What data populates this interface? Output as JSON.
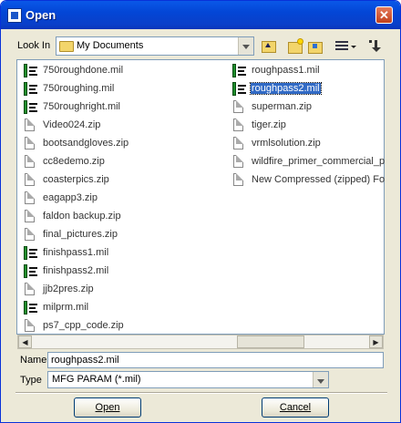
{
  "window": {
    "title": "Open",
    "close_glyph": "✕"
  },
  "lookin": {
    "label": "Look In",
    "value": "My Documents"
  },
  "toolbar": {
    "icons": [
      "up-folder-icon",
      "new-folder-icon",
      "home-folder-icon",
      "view-menu-icon",
      "details-icon"
    ]
  },
  "files": {
    "col1": [
      {
        "name": "750roughdone.mil",
        "type": "mil"
      },
      {
        "name": "750roughing.mil",
        "type": "mil"
      },
      {
        "name": "750roughright.mil",
        "type": "mil"
      },
      {
        "name": "Video024.zip",
        "type": "doc"
      },
      {
        "name": "bootsandgloves.zip",
        "type": "doc"
      },
      {
        "name": "cc8edemo.zip",
        "type": "doc"
      },
      {
        "name": "coasterpics.zip",
        "type": "doc"
      },
      {
        "name": "eagapp3.zip",
        "type": "doc"
      },
      {
        "name": "faldon backup.zip",
        "type": "doc"
      },
      {
        "name": "final_pictures.zip",
        "type": "doc"
      },
      {
        "name": "finishpass1.mil",
        "type": "mil"
      },
      {
        "name": "finishpass2.mil",
        "type": "mil"
      },
      {
        "name": "jjb2pres.zip",
        "type": "doc"
      },
      {
        "name": "milprm.mil",
        "type": "mil"
      },
      {
        "name": "ps7_cpp_code.zip",
        "type": "doc"
      }
    ],
    "col2": [
      {
        "name": "roughpass1.mil",
        "type": "mil"
      },
      {
        "name": "roughpass2.mil",
        "type": "mil",
        "selected": true
      },
      {
        "name": "superman.zip",
        "type": "doc"
      },
      {
        "name": "tiger.zip",
        "type": "doc"
      },
      {
        "name": "vrmlsolution.zip",
        "type": "doc"
      },
      {
        "name": "wildfire_primer_commercial_pa",
        "type": "doc"
      },
      {
        "name": "New Compressed (zipped) Folc",
        "type": "doc"
      }
    ]
  },
  "scrollbar": {
    "left_glyph": "◀",
    "right_glyph": "▶"
  },
  "name_field": {
    "label": "Name",
    "value": "roughpass2.mil"
  },
  "type_field": {
    "label": "Type",
    "value": "MFG PARAM (*.mil)"
  },
  "buttons": {
    "open": "Open",
    "cancel": "Cancel"
  }
}
